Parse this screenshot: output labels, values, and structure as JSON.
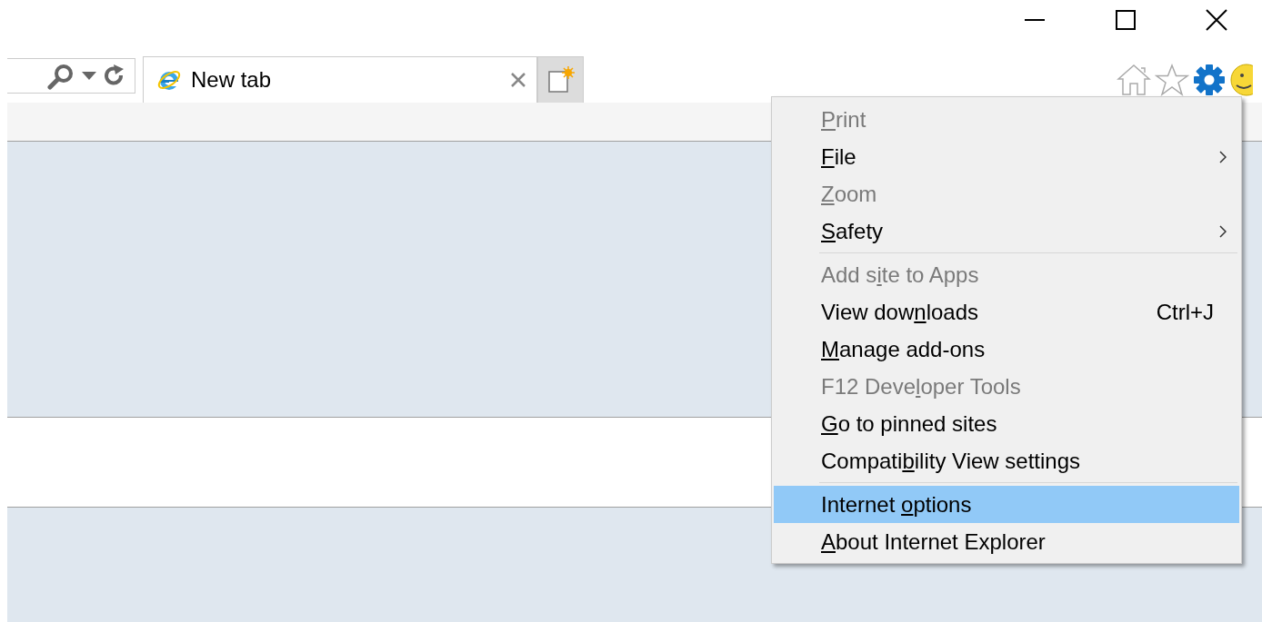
{
  "tabs": [
    {
      "label": "New tab",
      "selected": true
    }
  ],
  "menu": {
    "items": [
      {
        "kind": "item",
        "key": "P",
        "post": "rint",
        "disabled": true,
        "submenu": false,
        "selected": false
      },
      {
        "kind": "item",
        "key": "F",
        "post": "ile",
        "disabled": false,
        "submenu": true,
        "selected": false
      },
      {
        "kind": "item",
        "key": "Z",
        "post": "oom",
        "disabled": true,
        "submenu": false,
        "selected": false
      },
      {
        "kind": "item",
        "key": "S",
        "post": "afety",
        "disabled": false,
        "submenu": true,
        "selected": false
      },
      {
        "kind": "separator"
      },
      {
        "kind": "item",
        "pre": "Add s",
        "key": "i",
        "post": "te to Apps",
        "disabled": true,
        "submenu": false,
        "selected": false
      },
      {
        "kind": "item",
        "pre": "View dow",
        "key": "n",
        "post": "loads",
        "disabled": false,
        "submenu": false,
        "shortcut": "Ctrl+J",
        "selected": false
      },
      {
        "kind": "item",
        "key": "M",
        "post": "anage add-ons",
        "disabled": false,
        "submenu": false,
        "selected": false
      },
      {
        "kind": "item",
        "pre": "F12 Deve",
        "key": "l",
        "post": "oper Tools",
        "disabled": true,
        "submenu": false,
        "selected": false
      },
      {
        "kind": "item",
        "key": "G",
        "post": "o to pinned sites",
        "disabled": false,
        "submenu": false,
        "selected": false
      },
      {
        "kind": "item",
        "pre": "Compati",
        "key": "b",
        "post": "ility View settings",
        "disabled": false,
        "submenu": false,
        "selected": false
      },
      {
        "kind": "separator"
      },
      {
        "kind": "item",
        "pre": "Internet ",
        "key": "o",
        "post": "ptions",
        "disabled": false,
        "submenu": false,
        "selected": true
      },
      {
        "kind": "item",
        "key": "A",
        "post": "bout Internet Explorer",
        "disabled": false,
        "submenu": false,
        "selected": false
      }
    ]
  }
}
